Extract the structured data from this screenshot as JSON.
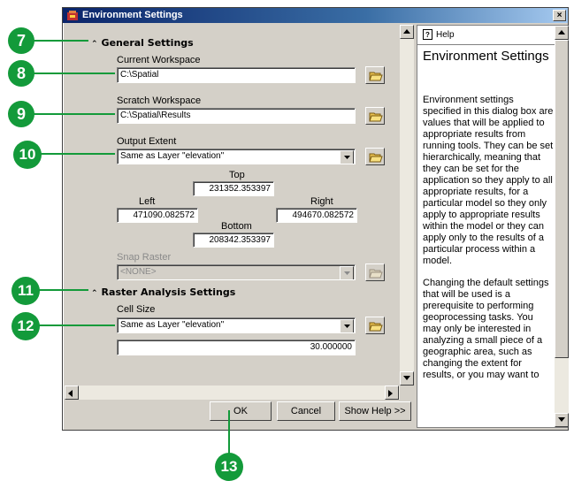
{
  "window": {
    "title": "Environment Settings",
    "close_glyph": "×"
  },
  "general": {
    "heading": "General Settings",
    "current_workspace": {
      "label": "Current Workspace",
      "value": "C:\\Spatial"
    },
    "scratch_workspace": {
      "label": "Scratch Workspace",
      "value": "C:\\Spatial\\Results"
    },
    "output_extent": {
      "label": "Output Extent",
      "value": "Same as Layer \"elevation\"",
      "top_label": "Top",
      "top": "231352.353397",
      "left_label": "Left",
      "left": "471090.082572",
      "right_label": "Right",
      "right": "494670.082572",
      "bottom_label": "Bottom",
      "bottom": "208342.353397"
    },
    "snap_raster": {
      "label": "Snap Raster",
      "value": "<NONE>"
    }
  },
  "raster": {
    "heading": "Raster Analysis Settings",
    "cell_size": {
      "label": "Cell Size",
      "value": "Same as Layer \"elevation\"",
      "number": "30.000000"
    }
  },
  "buttons": {
    "ok": "OK",
    "cancel": "Cancel",
    "show_help": "Show Help >>"
  },
  "help": {
    "tab": "Help",
    "title": "Environment Settings",
    "paragraph1": "Environment settings specified in this dialog box are values that will be applied to appropriate results from running tools. They can be set hierarchically, meaning that they can be set for the application so they apply to all appropriate results, for a particular model so they only apply to appropriate results within the model or they can apply only to the results of a particular process within a model.",
    "paragraph2": "Changing the default settings that will be used is a prerequisite to performing geoprocessing tasks. You may only be interested in analyzing a small piece of a geographic area, such as changing the extent for results, or you may want to"
  },
  "callouts": [
    "7",
    "8",
    "9",
    "10",
    "11",
    "12",
    "13"
  ],
  "colors": {
    "callout": "#139a3a",
    "title_bar": "#0a246a",
    "dialog": "#d4d0c8"
  }
}
